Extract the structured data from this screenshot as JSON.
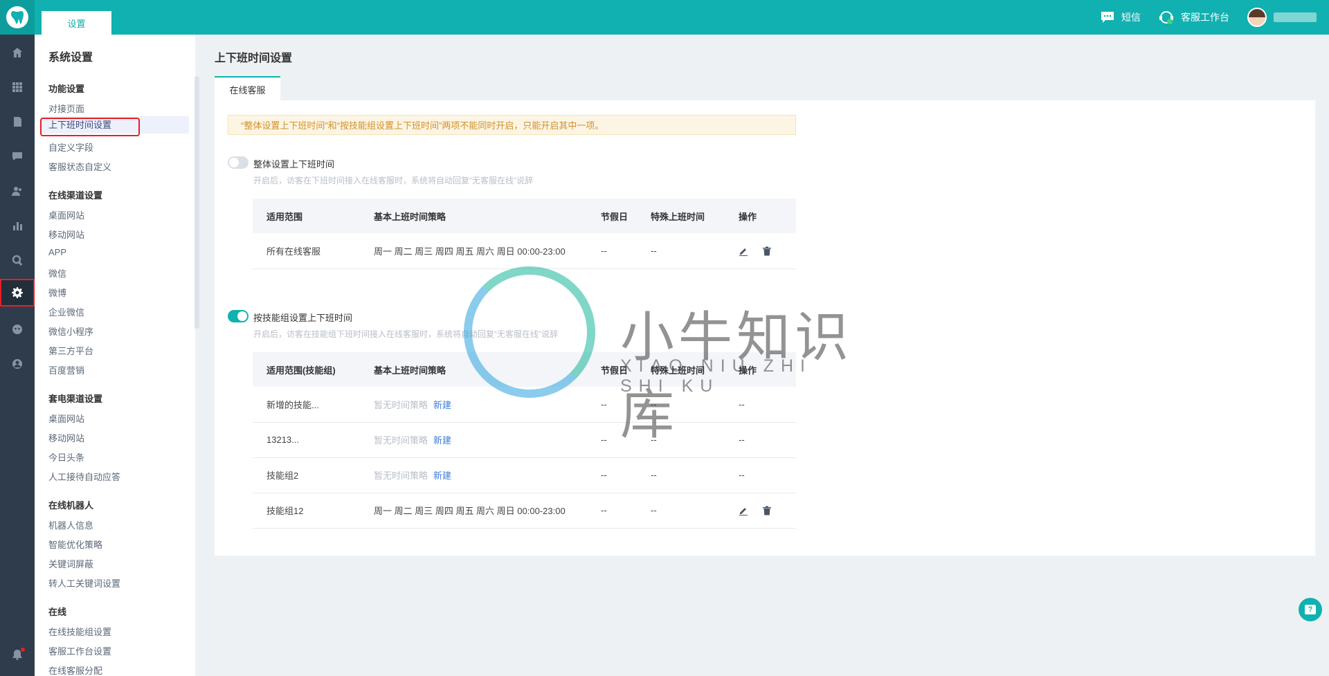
{
  "topbar": {
    "tab_label": "设置",
    "sms_label": "短信",
    "workbench_label": "客服工作台"
  },
  "rail": {
    "icons": [
      "home-icon",
      "apps-grid-icon",
      "document-icon",
      "chat-icon",
      "customers-icon",
      "stats-icon",
      "search-icon",
      "settings-icon",
      "robot-icon",
      "account-icon",
      "bell-icon"
    ],
    "active": "settings-icon"
  },
  "sidebar": {
    "title": "系统设置",
    "groups": [
      {
        "label": "功能设置",
        "items": [
          "对接页面",
          "上下班时间设置",
          "自定义字段",
          "客服状态自定义"
        ]
      },
      {
        "label": "在线渠道设置",
        "items": [
          "桌面网站",
          "移动网站",
          "APP",
          "微信",
          "微博",
          "企业微信",
          "微信小程序",
          "第三方平台",
          "百度营销"
        ]
      },
      {
        "label": "套电渠道设置",
        "items": [
          "桌面网站",
          "移动网站",
          "今日头条",
          "人工接待自动应答"
        ]
      },
      {
        "label": "在线机器人",
        "items": [
          "机器人信息",
          "智能优化策略",
          "关键词屏蔽",
          "转人工关键词设置"
        ]
      },
      {
        "label": "在线",
        "items": [
          "在线技能组设置",
          "客服工作台设置",
          "在线客服分配"
        ]
      }
    ],
    "selected": "上下班时间设置"
  },
  "main": {
    "title": "上下班时间设置",
    "tab": "在线客服",
    "warning": "“整体设置上下班时间”和“按技能组设置上下班时间”两项不能同时开启，只能开启其中一项。",
    "section1": {
      "label": "整体设置上下班时间",
      "enabled": false,
      "desc": "开启后，访客在下班时间接入在线客服时，系统将自动回复“无客服在线”说辞",
      "headers": [
        "适用范围",
        "基本上班时间策略",
        "节假日",
        "特殊上班时间",
        "操作"
      ],
      "rows": [
        {
          "scope": "所有在线客服",
          "policy": "周一 周二 周三 周四 周五 周六 周日 00:00-23:00",
          "holiday": "--",
          "special": "--"
        }
      ]
    },
    "section2": {
      "label": "按技能组设置上下班时间",
      "enabled": true,
      "desc": "开启后，访客在技能组下班时间接入在线客服时，系统将自动回复“无客服在线”说辞",
      "headers": [
        "适用范围(技能组)",
        "基本上班时间策略",
        "节假日",
        "特殊上班时间",
        "操作"
      ],
      "rows": [
        {
          "scope": "新增的技能...",
          "policy": "暂无时间策略",
          "new_link": "新建",
          "holiday": "--",
          "special": "--",
          "op": "--"
        },
        {
          "scope": "13213...",
          "policy": "暂无时间策略",
          "new_link": "新建",
          "holiday": "--",
          "special": "--",
          "op": "--"
        },
        {
          "scope": "技能组2",
          "policy": "暂无时间策略",
          "new_link": "新建",
          "holiday": "--",
          "special": "--",
          "op": "--"
        },
        {
          "scope": "技能组12",
          "policy": "周一 周二 周三 周四 周五 周六 周日 00:00-23:00",
          "holiday": "--",
          "special": "--"
        }
      ]
    }
  },
  "watermark": {
    "title": "小牛知识库",
    "subtitle": "XIAO NIU ZHI SHI KU"
  },
  "colors": {
    "brand": "#10b1b0",
    "rail": "#2f3c4c",
    "warning_text": "#d2902a",
    "highlight": "#e81e25",
    "link": "#3c7ed8"
  }
}
